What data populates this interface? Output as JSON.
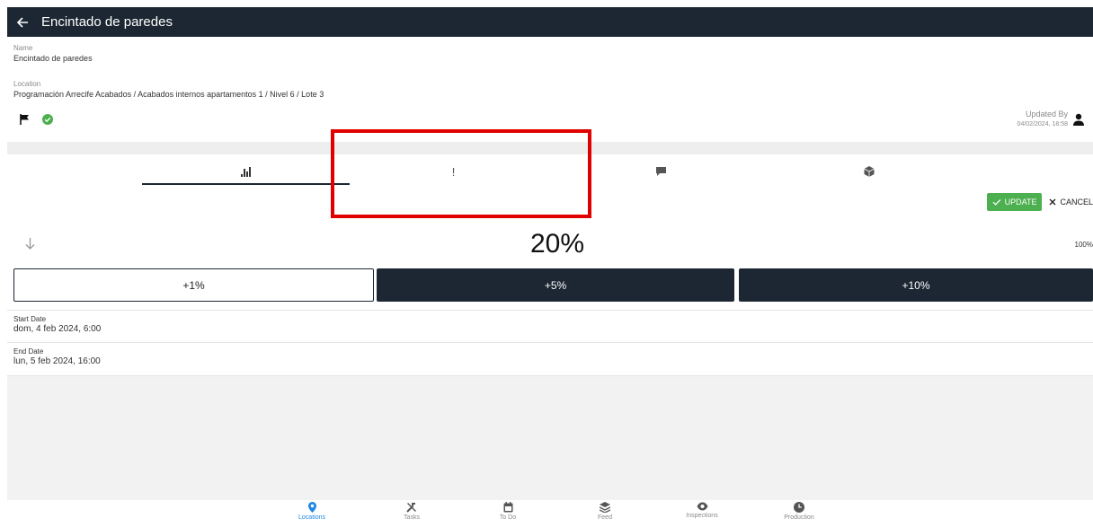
{
  "header": {
    "title": "Encintado de paredes"
  },
  "name": {
    "label": "Name",
    "value": "Encintado de paredes"
  },
  "location": {
    "label": "Location",
    "value": "Programación Arrecife Acabados / Acabados internos apartamentos 1 / Nivel 6 / Lote 3"
  },
  "updated": {
    "label": "Updated By",
    "date": "04/02/2024, 18:58"
  },
  "tabs": [
    {
      "icon": "bar-chart-icon",
      "active": true
    },
    {
      "icon": "exclamation-icon",
      "text": "!",
      "active": false
    },
    {
      "icon": "comment-icon",
      "active": false
    },
    {
      "icon": "cube-icon",
      "active": false
    }
  ],
  "actions": {
    "update": "UPDATE",
    "cancel": "CANCEL"
  },
  "progress": {
    "value": "20%",
    "max": "100%"
  },
  "increments": [
    "+1%",
    "+5%",
    "+10%"
  ],
  "start_date": {
    "label": "Start Date",
    "value": "dom, 4 feb 2024, 6:00"
  },
  "end_date": {
    "label": "End Date",
    "value": "lun, 5 feb 2024, 16:00"
  },
  "nav": [
    {
      "label": "Locations",
      "icon": "location-pin-icon",
      "active": true
    },
    {
      "label": "Tasks",
      "icon": "tools-icon",
      "active": false
    },
    {
      "label": "To Do",
      "icon": "calendar-icon",
      "active": false
    },
    {
      "label": "Feed",
      "icon": "layers-icon",
      "active": false
    },
    {
      "label": "Inspections",
      "icon": "eye-icon",
      "active": false
    },
    {
      "label": "Production",
      "icon": "clock-icon",
      "active": false
    }
  ],
  "colors": {
    "header_bg": "#1c2733",
    "success": "#4caf50",
    "accent": "#1e88e5",
    "highlight": "#e00000"
  }
}
